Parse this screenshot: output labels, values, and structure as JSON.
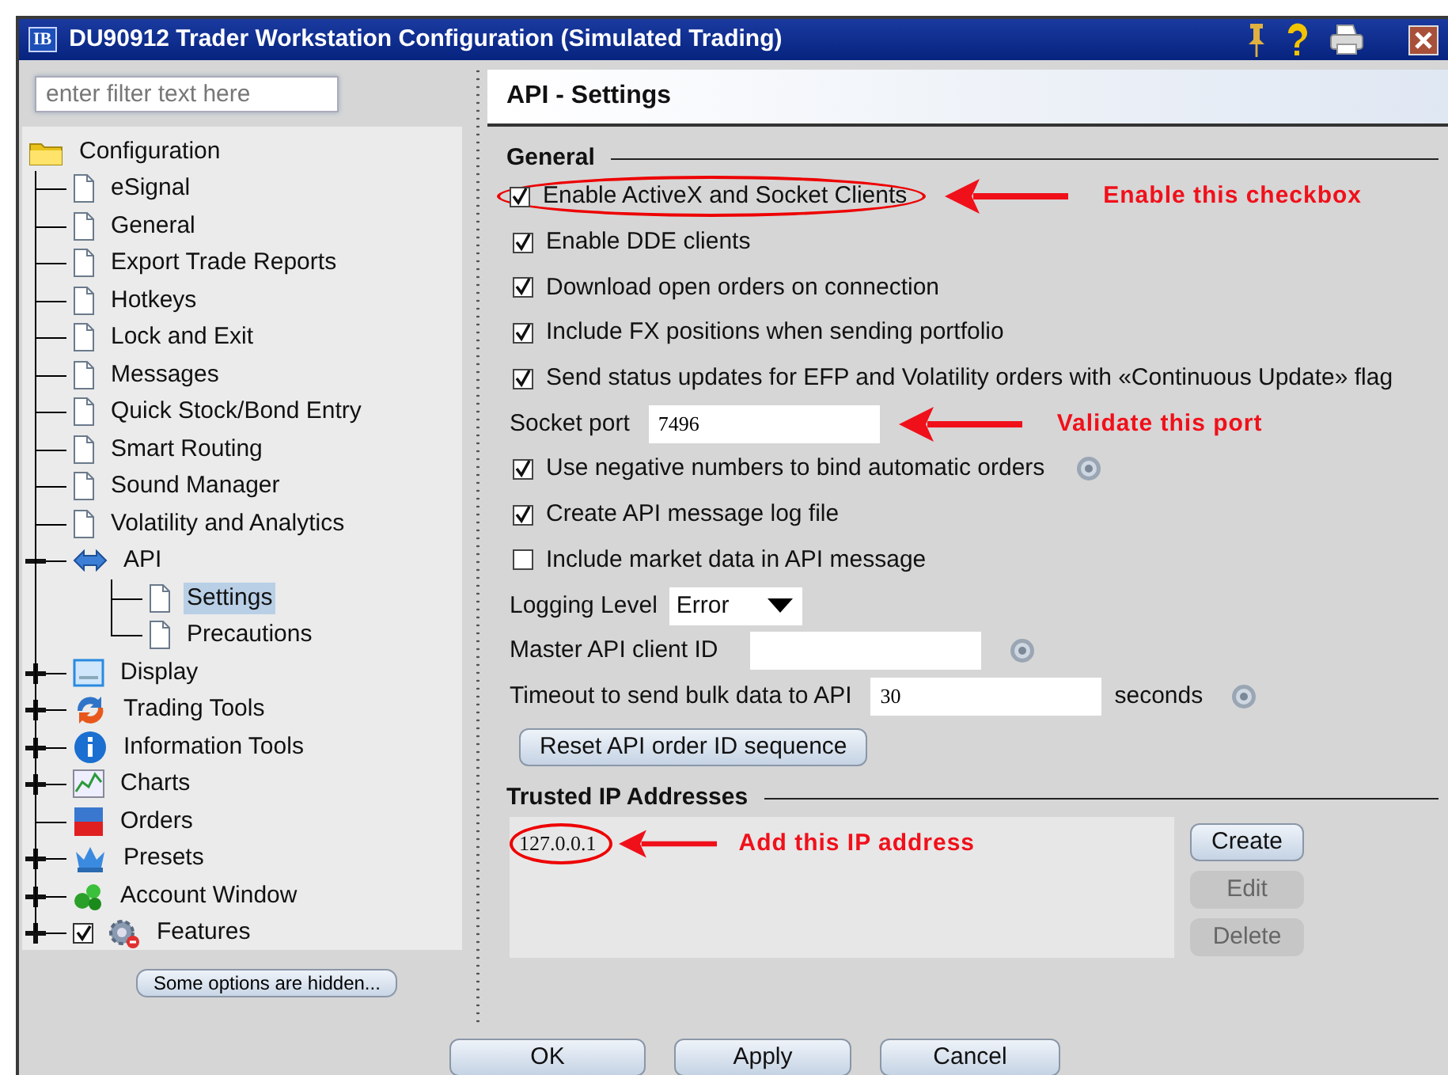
{
  "window": {
    "logo": "IB",
    "title": "DU90912 Trader Workstation Configuration (Simulated Trading)"
  },
  "filter": {
    "placeholder": "enter filter text here"
  },
  "tree": {
    "label": "Configuration",
    "kind": "folder",
    "selected": false,
    "children": [
      {
        "label": "eSignal",
        "kind": "page",
        "selected": false
      },
      {
        "label": "General",
        "kind": "page",
        "selected": false
      },
      {
        "label": "Export Trade Reports",
        "kind": "page",
        "selected": false
      },
      {
        "label": "Hotkeys",
        "kind": "page",
        "selected": false
      },
      {
        "label": "Lock and Exit",
        "kind": "page",
        "selected": false
      },
      {
        "label": "Messages",
        "kind": "page",
        "selected": false
      },
      {
        "label": "Quick Stock/Bond Entry",
        "kind": "page",
        "selected": false
      },
      {
        "label": "Smart Routing",
        "kind": "page",
        "selected": false
      },
      {
        "label": "Sound Manager",
        "kind": "page",
        "selected": false
      },
      {
        "label": "Volatility and Analytics",
        "kind": "page",
        "selected": false
      },
      {
        "label": "API",
        "kind": "arrows",
        "selected": false,
        "expanded": true,
        "children": [
          {
            "label": "Settings",
            "kind": "page",
            "selected": true
          },
          {
            "label": "Precautions",
            "kind": "page",
            "selected": false
          }
        ]
      },
      {
        "label": "Display",
        "kind": "display",
        "selected": false,
        "expanded": false
      },
      {
        "label": "Trading Tools",
        "kind": "cycle",
        "selected": false,
        "expanded": false
      },
      {
        "label": "Information Tools",
        "kind": "info",
        "selected": false,
        "expanded": false
      },
      {
        "label": "Charts",
        "kind": "chart",
        "selected": false,
        "expanded": false
      },
      {
        "label": "Orders",
        "kind": "orders",
        "selected": false
      },
      {
        "label": "Presets",
        "kind": "crown",
        "selected": false,
        "expanded": false
      },
      {
        "label": "Account Window",
        "kind": "coins",
        "selected": false,
        "expanded": false
      },
      {
        "label": "Features",
        "kind": "gears",
        "selected": false,
        "expanded": false,
        "checked": true
      }
    ]
  },
  "hidden_button": "Some options are hidden...",
  "panel_title": "API - Settings",
  "general": {
    "title": "General",
    "rows": [
      {
        "kind": "checkbox",
        "label": "Enable ActiveX and Socket Clients",
        "checked": true,
        "help": false,
        "circled": true,
        "callout": "Enable this checkbox"
      },
      {
        "kind": "checkbox",
        "label": "Enable DDE clients",
        "checked": true,
        "help": false
      },
      {
        "kind": "checkbox",
        "label": "Download open orders on connection",
        "checked": true,
        "help": false
      },
      {
        "kind": "checkbox",
        "label": "Include FX positions when sending portfolio",
        "checked": true,
        "help": false
      },
      {
        "kind": "checkbox",
        "label": "Send status updates for EFP and Volatility orders with «Continuous Update» flag",
        "checked": true,
        "help": false
      },
      {
        "kind": "field",
        "label": "Socket port",
        "value": "7496",
        "help": false,
        "callout": "Validate this port"
      },
      {
        "kind": "checkbox",
        "label": "Use negative numbers to bind automatic orders",
        "checked": true,
        "help": true
      },
      {
        "kind": "checkbox",
        "label": "Create API message log file",
        "checked": true,
        "help": false
      },
      {
        "kind": "checkbox",
        "label": "Include market data in API message",
        "checked": false,
        "help": false
      },
      {
        "kind": "select",
        "label": "Logging Level",
        "value": "Error",
        "help": false
      },
      {
        "kind": "field",
        "label": "Master API client ID",
        "help": true
      },
      {
        "kind": "field",
        "label": "Timeout to send bulk data to API",
        "value": "30",
        "suffix": "seconds",
        "help": true
      },
      {
        "kind": "button",
        "label": "Reset API order ID sequence",
        "help": false
      }
    ]
  },
  "trusted": {
    "title": "Trusted IP Addresses",
    "addresses": [
      {
        "text": "127.0.0.1",
        "circled": true,
        "callout": "Add this IP address"
      }
    ],
    "buttons": [
      {
        "label": "Create",
        "disabled": false
      },
      {
        "label": "Edit",
        "disabled": true
      },
      {
        "label": "Delete",
        "disabled": true
      }
    ]
  },
  "footer_buttons": [
    "OK",
    "Apply",
    "Cancel"
  ]
}
